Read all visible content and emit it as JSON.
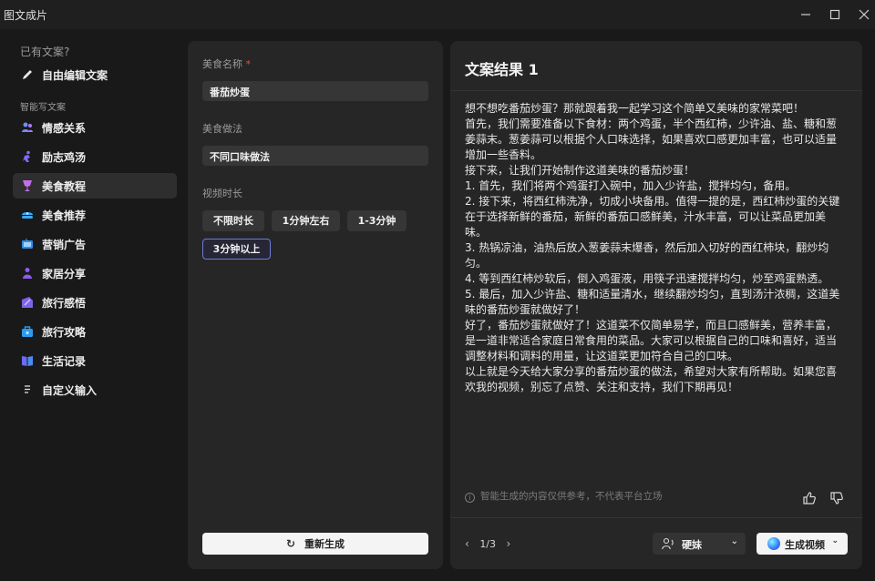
{
  "window": {
    "title": "图文成片"
  },
  "sidebar": {
    "header_existing": "已有文案?",
    "free_edit": "自由编辑文案",
    "header_smart": "智能写文案",
    "items": [
      {
        "label": "情感关系",
        "icon": "people-icon"
      },
      {
        "label": "励志鸡汤",
        "icon": "runner-icon"
      },
      {
        "label": "美食教程",
        "icon": "cup-icon",
        "active": true
      },
      {
        "label": "美食推荐",
        "icon": "food-icon"
      },
      {
        "label": "营销广告",
        "icon": "tv-icon"
      },
      {
        "label": "家居分享",
        "icon": "home-person-icon"
      },
      {
        "label": "旅行感悟",
        "icon": "travel-icon"
      },
      {
        "label": "旅行攻略",
        "icon": "bag-icon"
      },
      {
        "label": "生活记录",
        "icon": "book-icon"
      },
      {
        "label": "自定义输入",
        "icon": "doc-icon"
      }
    ]
  },
  "form": {
    "food_name_label": "美食名称",
    "required_mark": "*",
    "food_name_value": "番茄炒蛋",
    "method_label": "美食做法",
    "method_value": "不同口味做法",
    "duration_label": "视频时长",
    "duration_options": [
      "不限时长",
      "1分钟左右",
      "1-3分钟",
      "3分钟以上"
    ],
    "duration_selected": "3分钟以上",
    "regenerate": "重新生成"
  },
  "result": {
    "title": "文案结果 1",
    "paragraphs": [
      "想不想吃番茄炒蛋？那就跟着我一起学习这个简单又美味的家常菜吧！",
      "首先，我们需要准备以下食材：两个鸡蛋，半个西红柿，少许油、盐、糖和葱姜蒜末。葱姜蒜可以根据个人口味选择，如果喜欢口感更加丰富，也可以适量增加一些香料。",
      "接下来，让我们开始制作这道美味的番茄炒蛋！",
      "1. 首先，我们将两个鸡蛋打入碗中，加入少许盐，搅拌均匀，备用。",
      "2. 接下来，将西红柿洗净，切成小块备用。值得一提的是，西红柿炒蛋的关键在于选择新鲜的番茄，新鲜的番茄口感鲜美，汁水丰富，可以让菜品更加美味。",
      "3. 热锅凉油，油热后放入葱姜蒜末爆香，然后加入切好的西红柿块，翻炒均匀。",
      "4. 等到西红柿炒软后，倒入鸡蛋液，用筷子迅速搅拌均匀，炒至鸡蛋熟透。",
      "5. 最后，加入少许盐、糖和适量清水，继续翻炒均匀，直到汤汁浓稠，这道美味的番茄炒蛋就做好了！",
      "好了，番茄炒蛋就做好了！这道菜不仅简单易学，而且口感鲜美，营养丰富，是一道非常适合家庭日常食用的菜品。大家可以根据自己的口味和喜好，适当调整材料和调料的用量，让这道菜更加符合自己的口味。",
      "以上就是今天给大家分享的番茄炒蛋的做法，希望对大家有所帮助。如果您喜欢我的视频，别忘了点赞、关注和支持，我们下期再见！"
    ],
    "disclaimer": "智能生成的内容仅供参考，不代表平台立场",
    "pager": "1/3",
    "voice": "硬妹",
    "generate_video": "生成视频"
  }
}
